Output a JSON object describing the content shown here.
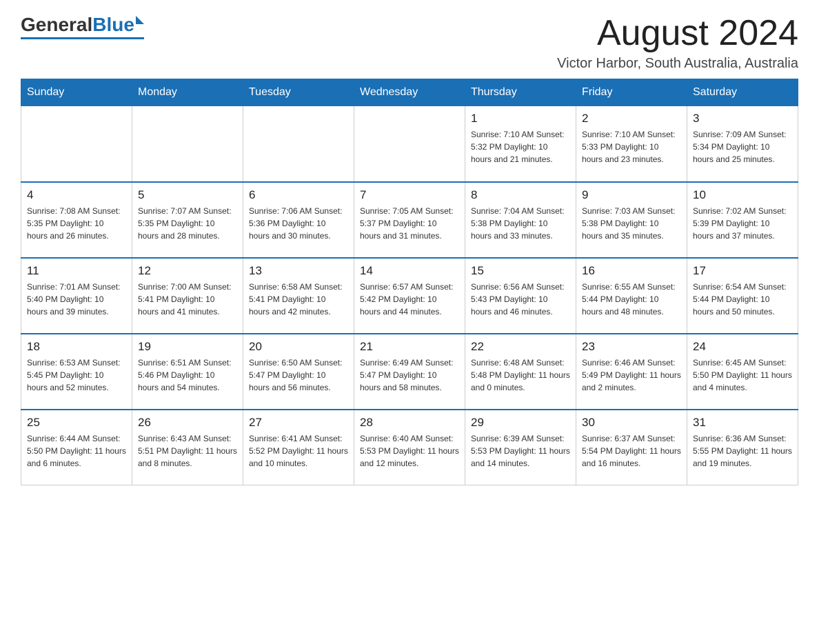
{
  "header": {
    "logo_general": "General",
    "logo_blue": "Blue",
    "month_year": "August 2024",
    "location": "Victor Harbor, South Australia, Australia"
  },
  "days_of_week": [
    "Sunday",
    "Monday",
    "Tuesday",
    "Wednesday",
    "Thursday",
    "Friday",
    "Saturday"
  ],
  "weeks": [
    [
      {
        "day": "",
        "info": ""
      },
      {
        "day": "",
        "info": ""
      },
      {
        "day": "",
        "info": ""
      },
      {
        "day": "",
        "info": ""
      },
      {
        "day": "1",
        "info": "Sunrise: 7:10 AM\nSunset: 5:32 PM\nDaylight: 10 hours and 21 minutes."
      },
      {
        "day": "2",
        "info": "Sunrise: 7:10 AM\nSunset: 5:33 PM\nDaylight: 10 hours and 23 minutes."
      },
      {
        "day": "3",
        "info": "Sunrise: 7:09 AM\nSunset: 5:34 PM\nDaylight: 10 hours and 25 minutes."
      }
    ],
    [
      {
        "day": "4",
        "info": "Sunrise: 7:08 AM\nSunset: 5:35 PM\nDaylight: 10 hours and 26 minutes."
      },
      {
        "day": "5",
        "info": "Sunrise: 7:07 AM\nSunset: 5:35 PM\nDaylight: 10 hours and 28 minutes."
      },
      {
        "day": "6",
        "info": "Sunrise: 7:06 AM\nSunset: 5:36 PM\nDaylight: 10 hours and 30 minutes."
      },
      {
        "day": "7",
        "info": "Sunrise: 7:05 AM\nSunset: 5:37 PM\nDaylight: 10 hours and 31 minutes."
      },
      {
        "day": "8",
        "info": "Sunrise: 7:04 AM\nSunset: 5:38 PM\nDaylight: 10 hours and 33 minutes."
      },
      {
        "day": "9",
        "info": "Sunrise: 7:03 AM\nSunset: 5:38 PM\nDaylight: 10 hours and 35 minutes."
      },
      {
        "day": "10",
        "info": "Sunrise: 7:02 AM\nSunset: 5:39 PM\nDaylight: 10 hours and 37 minutes."
      }
    ],
    [
      {
        "day": "11",
        "info": "Sunrise: 7:01 AM\nSunset: 5:40 PM\nDaylight: 10 hours and 39 minutes."
      },
      {
        "day": "12",
        "info": "Sunrise: 7:00 AM\nSunset: 5:41 PM\nDaylight: 10 hours and 41 minutes."
      },
      {
        "day": "13",
        "info": "Sunrise: 6:58 AM\nSunset: 5:41 PM\nDaylight: 10 hours and 42 minutes."
      },
      {
        "day": "14",
        "info": "Sunrise: 6:57 AM\nSunset: 5:42 PM\nDaylight: 10 hours and 44 minutes."
      },
      {
        "day": "15",
        "info": "Sunrise: 6:56 AM\nSunset: 5:43 PM\nDaylight: 10 hours and 46 minutes."
      },
      {
        "day": "16",
        "info": "Sunrise: 6:55 AM\nSunset: 5:44 PM\nDaylight: 10 hours and 48 minutes."
      },
      {
        "day": "17",
        "info": "Sunrise: 6:54 AM\nSunset: 5:44 PM\nDaylight: 10 hours and 50 minutes."
      }
    ],
    [
      {
        "day": "18",
        "info": "Sunrise: 6:53 AM\nSunset: 5:45 PM\nDaylight: 10 hours and 52 minutes."
      },
      {
        "day": "19",
        "info": "Sunrise: 6:51 AM\nSunset: 5:46 PM\nDaylight: 10 hours and 54 minutes."
      },
      {
        "day": "20",
        "info": "Sunrise: 6:50 AM\nSunset: 5:47 PM\nDaylight: 10 hours and 56 minutes."
      },
      {
        "day": "21",
        "info": "Sunrise: 6:49 AM\nSunset: 5:47 PM\nDaylight: 10 hours and 58 minutes."
      },
      {
        "day": "22",
        "info": "Sunrise: 6:48 AM\nSunset: 5:48 PM\nDaylight: 11 hours and 0 minutes."
      },
      {
        "day": "23",
        "info": "Sunrise: 6:46 AM\nSunset: 5:49 PM\nDaylight: 11 hours and 2 minutes."
      },
      {
        "day": "24",
        "info": "Sunrise: 6:45 AM\nSunset: 5:50 PM\nDaylight: 11 hours and 4 minutes."
      }
    ],
    [
      {
        "day": "25",
        "info": "Sunrise: 6:44 AM\nSunset: 5:50 PM\nDaylight: 11 hours and 6 minutes."
      },
      {
        "day": "26",
        "info": "Sunrise: 6:43 AM\nSunset: 5:51 PM\nDaylight: 11 hours and 8 minutes."
      },
      {
        "day": "27",
        "info": "Sunrise: 6:41 AM\nSunset: 5:52 PM\nDaylight: 11 hours and 10 minutes."
      },
      {
        "day": "28",
        "info": "Sunrise: 6:40 AM\nSunset: 5:53 PM\nDaylight: 11 hours and 12 minutes."
      },
      {
        "day": "29",
        "info": "Sunrise: 6:39 AM\nSunset: 5:53 PM\nDaylight: 11 hours and 14 minutes."
      },
      {
        "day": "30",
        "info": "Sunrise: 6:37 AM\nSunset: 5:54 PM\nDaylight: 11 hours and 16 minutes."
      },
      {
        "day": "31",
        "info": "Sunrise: 6:36 AM\nSunset: 5:55 PM\nDaylight: 11 hours and 19 minutes."
      }
    ]
  ]
}
